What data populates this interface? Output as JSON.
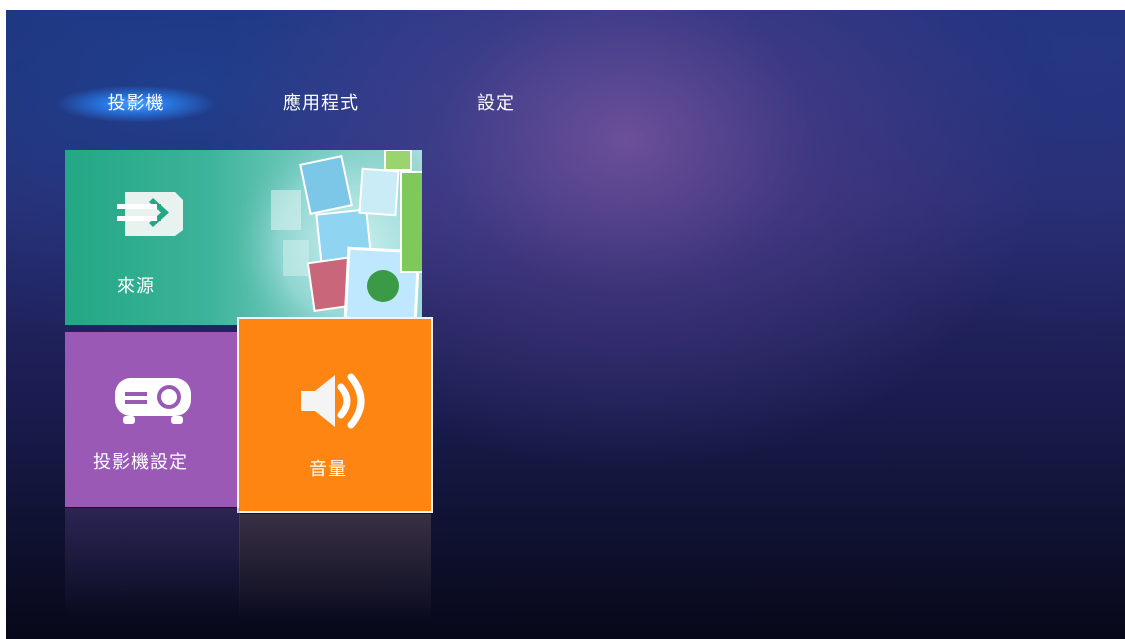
{
  "nav": {
    "tabs": [
      {
        "label": "投影機",
        "active": true
      },
      {
        "label": "應用程式",
        "active": false
      },
      {
        "label": "設定",
        "active": false
      }
    ]
  },
  "tiles": {
    "source": {
      "label": "來源",
      "icon": "input-arrow-icon",
      "color": "#23a784"
    },
    "projector_settings": {
      "label": "投影機設定",
      "icon": "projector-icon",
      "color": "#9b59b6"
    },
    "volume": {
      "label": "音量",
      "icon": "speaker-icon",
      "color": "#ff8512",
      "selected": true
    }
  }
}
